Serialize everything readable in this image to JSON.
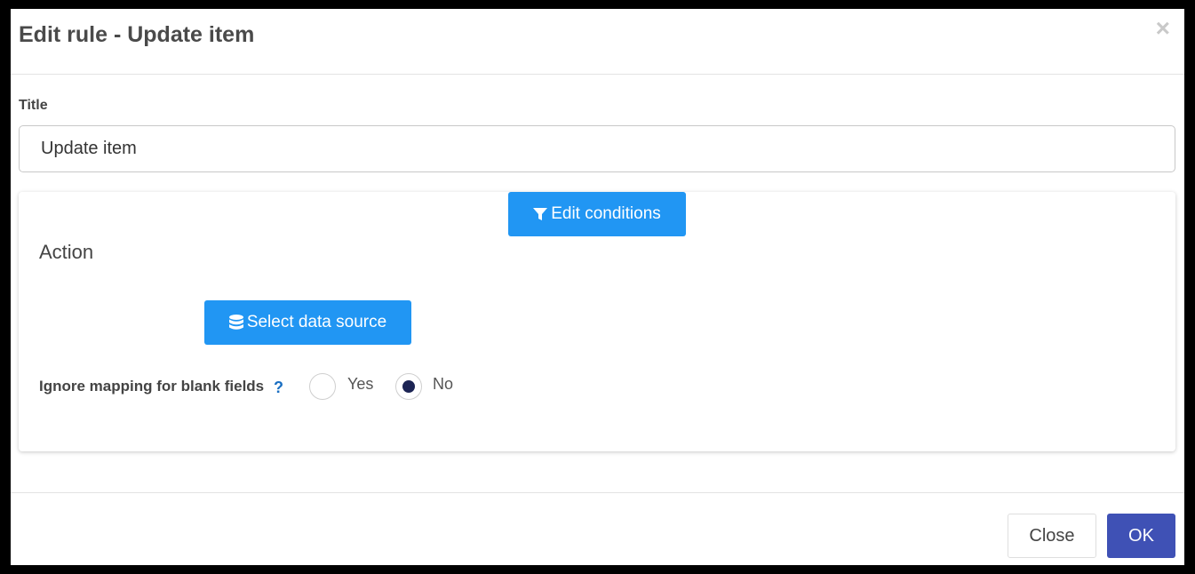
{
  "dialog": {
    "title": "Edit rule - Update item",
    "close_glyph": "×"
  },
  "form": {
    "title_label": "Title",
    "title_value": "Update item"
  },
  "card": {
    "edit_conditions_label": "Edit conditions",
    "edit_conditions_icon": "filter-icon",
    "action_heading": "Action",
    "select_source_label": "Select data source",
    "select_source_icon": "database-icon",
    "ignore_mapping_label": "Ignore mapping for blank fields",
    "help_glyph": "?",
    "radio_yes_label": "Yes",
    "radio_no_label": "No",
    "selected_option": "No"
  },
  "footer": {
    "close_label": "Close",
    "ok_label": "OK"
  },
  "colors": {
    "primary_blue": "#2196f3",
    "ok_indigo": "#3f51b5",
    "radio_selected": "#1c2454",
    "help_blue": "#1a6fc2"
  }
}
